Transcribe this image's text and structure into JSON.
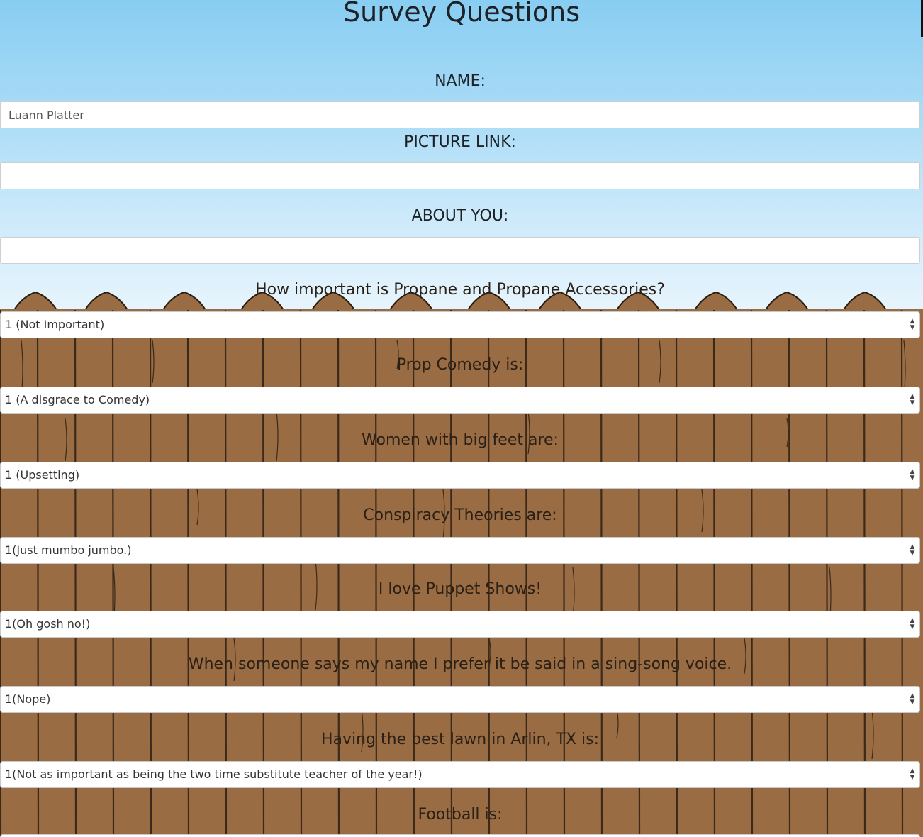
{
  "page": {
    "title": "Survey Questions"
  },
  "form": {
    "name_label": "NAME:",
    "name_value": "Luann Platter",
    "picture_label": "PICTURE LINK:",
    "picture_value": "",
    "about_label": "ABOUT YOU:",
    "about_value": ""
  },
  "questions": [
    {
      "label": "How important is Propane and Propane Accessories?",
      "selected": "1 (Not Important)"
    },
    {
      "label": "Prop Comedy is:",
      "selected": "1 (A disgrace to Comedy)"
    },
    {
      "label": "Women with big feet are:",
      "selected": "1 (Upsetting)"
    },
    {
      "label": "Conspiracy Theories are:",
      "selected": "1(Just mumbo jumbo.)"
    },
    {
      "label": "I love Puppet Shows!",
      "selected": "1(Oh gosh no!)"
    },
    {
      "label": "When someone says my name I prefer it be said in a sing-song voice.",
      "selected": "1(Nope)"
    },
    {
      "label": "Having the best lawn in Arlin, TX is:",
      "selected": "1(Not as important as being the two time substitute teacher of the year!)"
    },
    {
      "label": "Football is:",
      "selected": ""
    }
  ],
  "icons": {
    "select_arrow": "up-down-caret-icon"
  },
  "colors": {
    "sky_top": "#88cdf2",
    "sky_bottom": "#e8f5fd",
    "fence": "#9a6c43",
    "fence_line": "#3b2a1a"
  }
}
